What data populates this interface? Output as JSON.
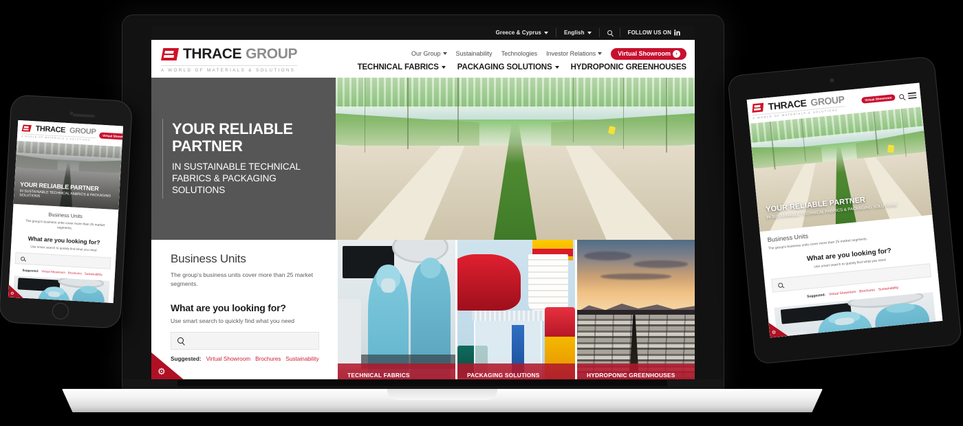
{
  "brand": {
    "name_part1": "THRACE",
    "name_part2": "GROUP",
    "tagline": "A WORLD OF MATERIALS & SOLUTIONS",
    "accent_red": "#c8102e",
    "caption_red": "#b0182c",
    "logo_gray": "#8d8d8d"
  },
  "utilbar": {
    "region": "Greece & Cyprus",
    "language": "English",
    "search_icon": "search-icon",
    "follow_label": "FOLLOW US ON",
    "social_icon": "linkedin-icon"
  },
  "nav_primary": [
    {
      "label": "Our Group",
      "has_caret": true
    },
    {
      "label": "Sustainability",
      "has_caret": false
    },
    {
      "label": "Technologies",
      "has_caret": false
    },
    {
      "label": "Investor Relations",
      "has_caret": true
    }
  ],
  "cta": {
    "label": "Virtual Showroom",
    "arrow": "›"
  },
  "nav_secondary": [
    {
      "label": "TECHNICAL FABRICS",
      "has_caret": true
    },
    {
      "label": "PACKAGING SOLUTIONS",
      "has_caret": true
    },
    {
      "label": "HYDROPONIC GREENHOUSES",
      "has_caret": false
    }
  ],
  "hero": {
    "headline_line1": "YOUR RELIABLE",
    "headline_line2": "PARTNER",
    "subhead": "IN SUSTAINABLE TECHNICAL FABRICS & PACKAGING SOLUTIONS",
    "headline_mobile": "YOUR RELIABLE PARTNER",
    "image_alt": "hydroponic-greenhouse-interior"
  },
  "business_units": {
    "title": "Business Units",
    "description": "The group's business units cover more than 25 market segments."
  },
  "search": {
    "title": "What are you looking for?",
    "subtitle": "Use smart search to quickly find what you need",
    "placeholder": "",
    "value": "",
    "icon": "search-icon",
    "suggested_label": "Suggested:",
    "suggested_links": [
      "Virtual Showroom",
      "Brochures",
      "Sustainability"
    ]
  },
  "tiles": [
    {
      "label": "TECHNICAL FABRICS",
      "art": "medical-operating-room"
    },
    {
      "label": "PACKAGING SOLUTIONS",
      "art": "plastic-containers"
    },
    {
      "label": "HYDROPONIC GREENHOUSES",
      "art": "greenhouse-roofs-sunset"
    }
  ],
  "corner_badge": {
    "icon": "gear-icon",
    "glyph": "⚙"
  },
  "mobile": {
    "cta_label": "Virtual Showroom",
    "search_icon": "search-icon",
    "menu_icon": "hamburger-menu-icon"
  },
  "devices": {
    "laptop": "macbook-laptop-mockup",
    "tablet": "tablet-mockup",
    "phone": "smartphone-mockup"
  }
}
